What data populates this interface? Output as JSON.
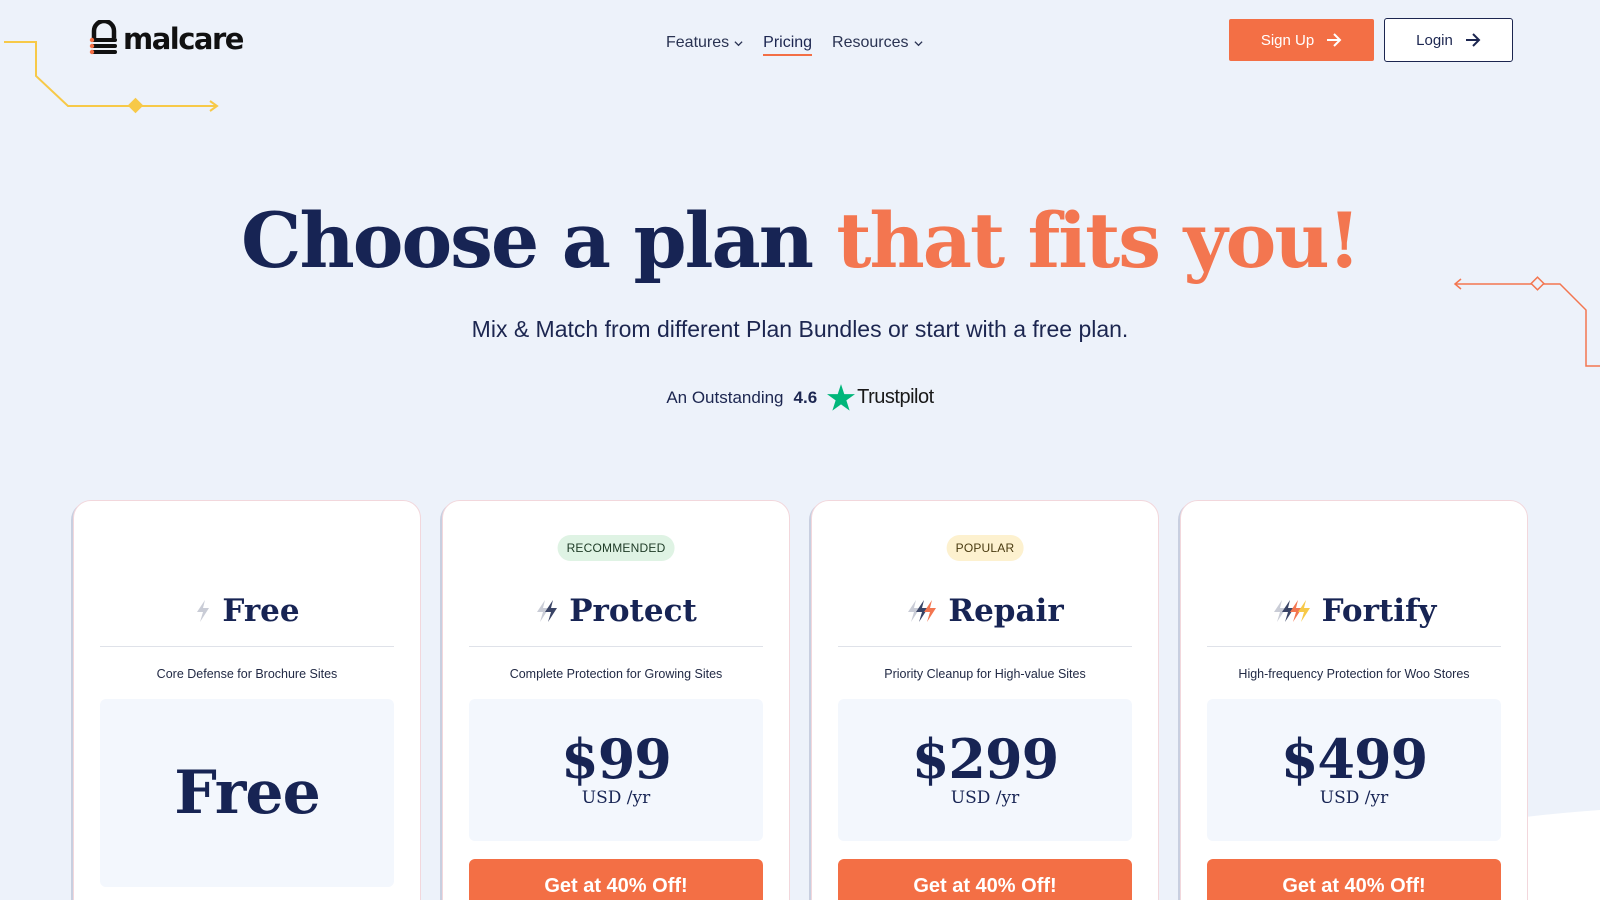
{
  "header": {
    "logo_text": "malcare",
    "nav": [
      {
        "label": "Features",
        "dropdown": true
      },
      {
        "label": "Pricing",
        "dropdown": false,
        "active": true
      },
      {
        "label": "Resources",
        "dropdown": true
      }
    ],
    "signup_label": "Sign Up",
    "login_label": "Login"
  },
  "hero": {
    "title_main": "Choose a plan ",
    "title_accent": "that fits you!",
    "subtitle": "Mix & Match from different Plan Bundles or start with a free plan.",
    "rating_prefix": "An Outstanding",
    "rating_score": "4.6",
    "rating_brand": "Trustpilot"
  },
  "plans": [
    {
      "name": "Free",
      "badge": "",
      "tagline": "Core Defense for Brochure Sites",
      "price": "Free",
      "period": "",
      "cta": ""
    },
    {
      "name": "Protect",
      "badge": "RECOMMENDED",
      "tagline": "Complete Protection for Growing Sites",
      "price": "$99",
      "period": "USD /yr",
      "cta": "Get at 40% Off!"
    },
    {
      "name": "Repair",
      "badge": "POPULAR",
      "tagline": "Priority Cleanup for High-value Sites",
      "price": "$299",
      "period": "USD /yr",
      "cta": "Get at 40% Off!"
    },
    {
      "name": "Fortify",
      "badge": "",
      "tagline": "High-frequency Protection for Woo Stores",
      "price": "$499",
      "period": "USD /yr",
      "cta": "Get at 40% Off!"
    }
  ],
  "colors": {
    "accent": "#f36f45",
    "navy": "#172454",
    "background": "#edf2fa",
    "decor_yellow": "#f7c948"
  },
  "icons": [
    "lock-logo-icon",
    "chevron-down-icon",
    "arrow-right-icon",
    "trustpilot-star-icon",
    "bolt-icon"
  ]
}
